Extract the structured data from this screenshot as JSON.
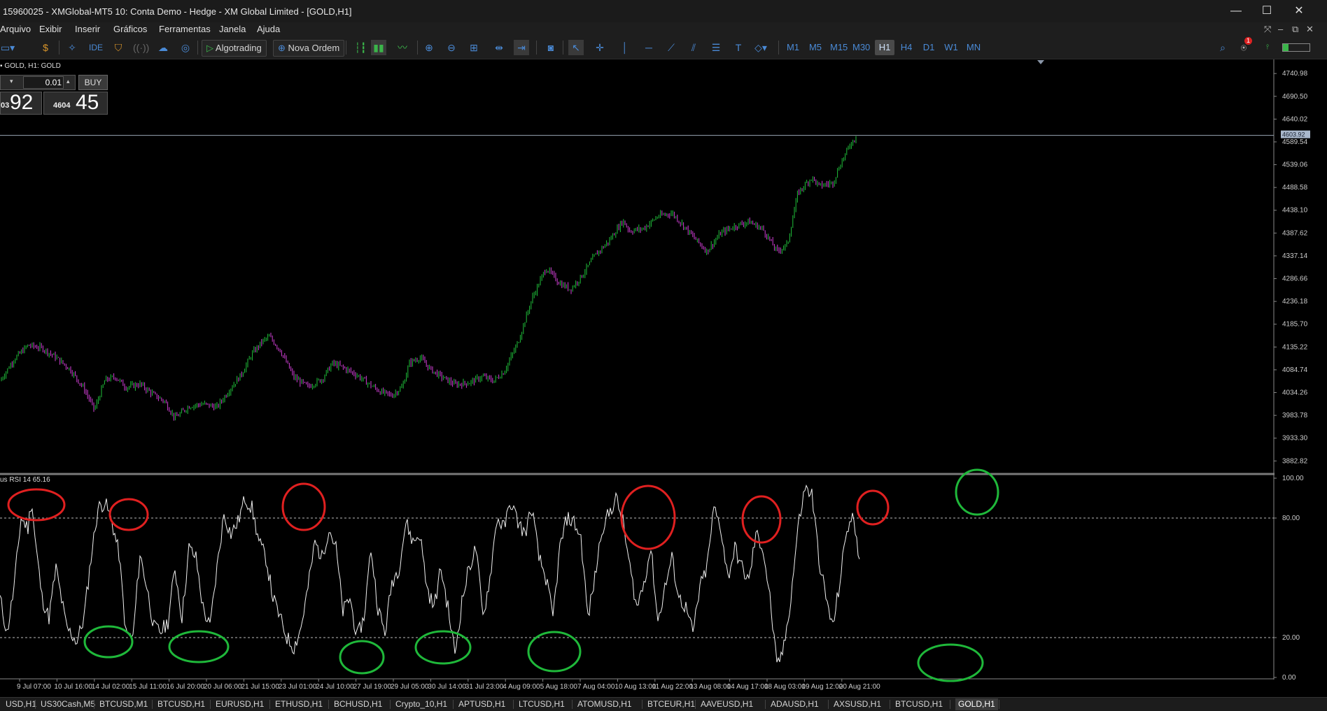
{
  "window": {
    "title": "15960025 - XMGlobal-MT5 10: Conta Demo - Hedge - XM Global Limited - [GOLD,H1]",
    "controls": {
      "minimize": "—",
      "maximize": "☐",
      "close": "✕"
    }
  },
  "menu": {
    "items": [
      "Arquivo",
      "Exibir",
      "Inserir",
      "Gráficos",
      "Ferramentas",
      "Janela",
      "Ajuda"
    ],
    "right_controls": [
      "⤧",
      "–",
      "⧉",
      "✕"
    ]
  },
  "toolbar": {
    "algotrading_label": "Algotrading",
    "new_order_label": "Nova Ordem",
    "ide_label": "IDE",
    "timeframes": [
      "M1",
      "M5",
      "M15",
      "M30",
      "H1",
      "H4",
      "D1",
      "W1",
      "MN"
    ],
    "active_timeframe": "H1",
    "notification_count": "1"
  },
  "chart": {
    "header": "GOLD, H1:  GOLD",
    "trade_panel": {
      "lot": "0.01",
      "buy_label": "BUY",
      "sell_price_small": "03",
      "sell_price_big": "92",
      "buy_price_small": "4604",
      "buy_price_big": "45"
    },
    "current_price_label": "4603.92"
  },
  "chart_data": [
    {
      "type": "candlestick",
      "symbol": "GOLD",
      "timeframe": "H1",
      "ylim": [
        3857,
        4766
      ],
      "yticks": [
        "4740.98",
        "4690.50",
        "4640.02",
        "4589.54",
        "4539.06",
        "4488.58",
        "4438.10",
        "4387.62",
        "4337.14",
        "4286.66",
        "4236.18",
        "4185.70",
        "4135.22",
        "4084.74",
        "4034.26",
        "3983.78",
        "3933.30",
        "3882.82"
      ],
      "current_price": 4603.92,
      "close_path": {
        "x": [
          0,
          20,
          40,
          60,
          80,
          100,
          120,
          135,
          150,
          165,
          180,
          200,
          220,
          235,
          250,
          270,
          290,
          310,
          330,
          345,
          360,
          375,
          385,
          400,
          420,
          440,
          460,
          475,
          490,
          510,
          530,
          545,
          560,
          575,
          585,
          600,
          615,
          630,
          650,
          670,
          690,
          705,
          720,
          740,
          760,
          780,
          800,
          815,
          830,
          850,
          870,
          890,
          900,
          920,
          940,
          960,
          975,
          990,
          1010,
          1030,
          1050,
          1070,
          1090,
          1110,
          1125,
          1140,
          1160,
          1170,
          1190,
          1200,
          1215,
          1225
        ],
        "y": [
          4060,
          4108,
          4139,
          4133,
          4112,
          4086,
          4043,
          3996,
          4062,
          4069,
          4046,
          4053,
          4029,
          4015,
          3978,
          4004,
          4009,
          4002,
          4045,
          4075,
          4120,
          4148,
          4158,
          4129,
          4068,
          4047,
          4064,
          4099,
          4090,
          4073,
          4050,
          4035,
          4028,
          4047,
          4100,
          4112,
          4086,
          4070,
          4052,
          4056,
          4070,
          4060,
          4080,
          4145,
          4242,
          4310,
          4276,
          4263,
          4290,
          4338,
          4370,
          4415,
          4392,
          4398,
          4425,
          4432,
          4407,
          4380,
          4347,
          4388,
          4403,
          4413,
          4396,
          4347,
          4362,
          4477,
          4511,
          4492,
          4499,
          4538,
          4585,
          4604
        ]
      }
    },
    {
      "type": "line",
      "indicator": "RSI",
      "period": 14,
      "value": 65.16,
      "label": "us RSI 14 65.16",
      "ylim": [
        0,
        100
      ],
      "yticks": [
        "100.00",
        "80.00",
        "20.00",
        "0.00"
      ],
      "levels": [
        80,
        20
      ],
      "x": [
        0,
        10,
        20,
        30,
        40,
        45,
        50,
        60,
        70,
        80,
        95,
        110,
        120,
        130,
        140,
        150,
        160,
        170,
        180,
        190,
        200,
        210,
        220,
        230,
        240,
        250,
        260,
        270,
        280,
        290,
        300,
        310,
        320,
        330,
        340,
        350,
        360,
        370,
        380,
        390,
        400,
        410,
        420,
        430,
        440,
        450,
        460,
        470,
        480,
        490,
        500,
        510,
        520,
        530,
        540,
        550,
        560,
        570,
        580,
        590,
        600,
        610,
        620,
        630,
        640,
        650,
        660,
        670,
        680,
        690,
        700,
        710,
        720,
        730,
        740,
        750,
        760,
        770,
        780,
        790,
        800,
        810,
        820,
        830,
        840,
        850,
        860,
        870,
        880,
        890,
        900,
        910,
        920,
        930,
        940,
        950,
        960,
        970,
        980,
        990,
        1000,
        1010,
        1020,
        1030,
        1040,
        1050,
        1060,
        1070,
        1080,
        1090,
        1100,
        1110,
        1120,
        1130,
        1140,
        1150,
        1160,
        1170,
        1180,
        1190,
        1200,
        1210,
        1220,
        1228
      ],
      "y": [
        40,
        22,
        45,
        80,
        75,
        90,
        70,
        40,
        30,
        55,
        25,
        18,
        30,
        60,
        85,
        88,
        78,
        62,
        22,
        20,
        62,
        45,
        25,
        23,
        28,
        55,
        30,
        65,
        60,
        35,
        25,
        55,
        82,
        72,
        78,
        90,
        85,
        68,
        60,
        40,
        30,
        20,
        15,
        25,
        45,
        68,
        60,
        75,
        65,
        33,
        40,
        20,
        30,
        65,
        35,
        22,
        48,
        55,
        78,
        68,
        72,
        45,
        35,
        55,
        35,
        12,
        38,
        55,
        65,
        30,
        50,
        80,
        75,
        88,
        78,
        72,
        85,
        60,
        50,
        30,
        65,
        80,
        78,
        70,
        30,
        50,
        75,
        82,
        90,
        78,
        55,
        35,
        48,
        65,
        28,
        45,
        60,
        40,
        35,
        22,
        45,
        55,
        85,
        75,
        50,
        65,
        55,
        48,
        72,
        65,
        40,
        5,
        15,
        40,
        75,
        95,
        92,
        60,
        40,
        25,
        48,
        75,
        80,
        60
      ]
    }
  ],
  "time_axis": [
    "9 Jul 07:00",
    "10 Jul 16:00",
    "14 Jul 02:00",
    "15 Jul 11:00",
    "16 Jul 20:00",
    "20 Jul 06:00",
    "21 Jul 15:00",
    "23 Jul 01:00",
    "24 Jul 10:00",
    "27 Jul 19:00",
    "29 Jul 05:00",
    "30 Jul 14:00",
    "31 Jul 23:00",
    "4 Aug 09:00",
    "5 Aug 18:00",
    "7 Aug 04:00",
    "10 Aug 13:00",
    "11 Aug 22:00",
    "13 Aug 08:00",
    "14 Aug 17:00",
    "18 Aug 03:00",
    "19 Aug 12:00",
    "20 Aug 21:00"
  ],
  "annotations": {
    "red_color": "#e02020",
    "green_color": "#1fb83a"
  },
  "tabs": [
    "USD,H1",
    "US30Cash,M5",
    "BTCUSD,M1",
    "BTCUSD,H1",
    "EURUSD,H1",
    "ETHUSD,H1",
    "BCHUSD,H1",
    "Crypto_10,H1",
    "APTUSD,H1",
    "LTCUSD,H1",
    "ATOMUSD,H1",
    "BTCEUR,H1",
    "AAVEUSD,H1",
    "ADAUSD,H1",
    "AXSUSD,H1",
    "BTCUSD,H1",
    "GOLD,H1"
  ],
  "active_tab": "GOLD,H1"
}
